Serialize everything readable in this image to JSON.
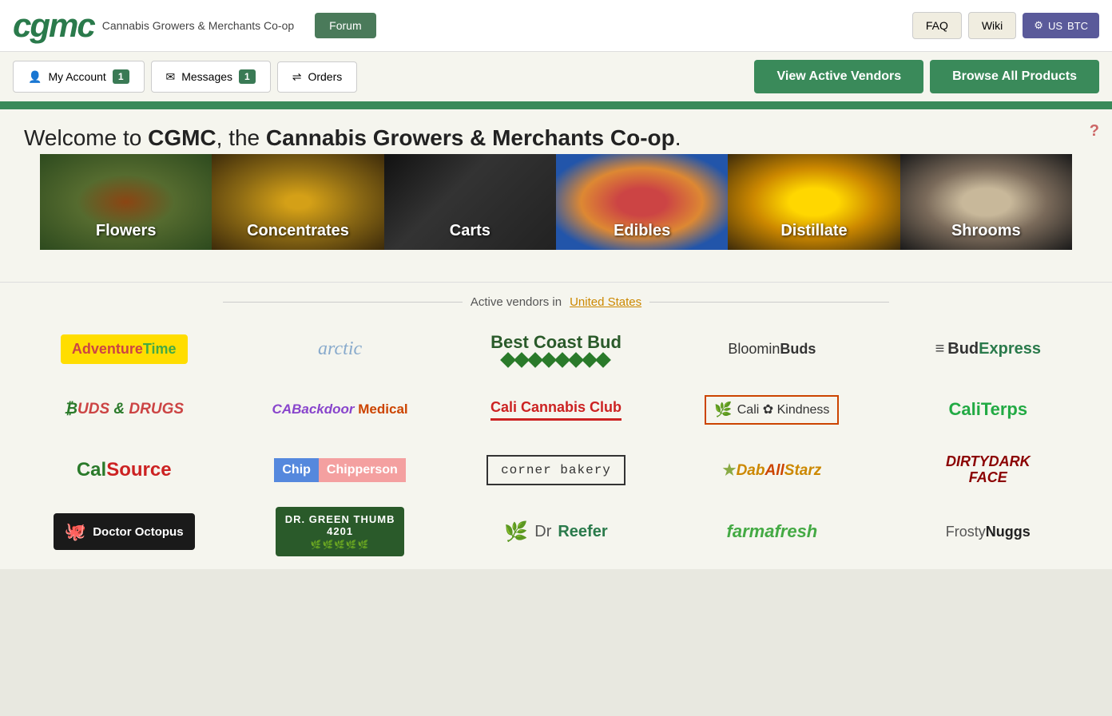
{
  "header": {
    "logo": "cgmc",
    "subtitle": "Cannabis Growers & Merchants Co-op",
    "forum_label": "Forum",
    "faq_label": "FAQ",
    "wiki_label": "Wiki",
    "settings_icon": "gear",
    "region": "US",
    "currency": "BTC"
  },
  "nav": {
    "my_account": "My Account",
    "my_account_badge": "1",
    "messages": "Messages",
    "messages_badge": "1",
    "orders": "Orders",
    "view_vendors": "View Active Vendors",
    "browse_products": "Browse All Products"
  },
  "welcome": {
    "text": "Welcome to CGMC, the Cannabis Growers & Merchants Co-op."
  },
  "categories": [
    {
      "id": "flowers",
      "label": "Flowers",
      "css_class": "cat-flowers"
    },
    {
      "id": "concentrates",
      "label": "Concentrates",
      "css_class": "cat-concentrates"
    },
    {
      "id": "carts",
      "label": "Carts",
      "css_class": "cat-carts"
    },
    {
      "id": "edibles",
      "label": "Edibles",
      "css_class": "cat-edibles"
    },
    {
      "id": "distillate",
      "label": "Distillate",
      "css_class": "cat-distillate"
    },
    {
      "id": "shrooms",
      "label": "Shrooms",
      "css_class": "cat-shrooms"
    }
  ],
  "vendors_header": {
    "prefix": "Active vendors in",
    "location": "United States"
  },
  "vendors": [
    {
      "id": "adventure-time",
      "name": "AdventureTime"
    },
    {
      "id": "arctic",
      "name": "arctic"
    },
    {
      "id": "best-coast-bud",
      "name": "Best Coast Bud"
    },
    {
      "id": "bloomin-buds",
      "name": "BloominBuds"
    },
    {
      "id": "bud-express",
      "name": "BudExpress"
    },
    {
      "id": "buds-drugs",
      "name": "Buds & Drugs"
    },
    {
      "id": "ca-backdoor",
      "name": "CABackdoor Medical"
    },
    {
      "id": "cali-cannabis",
      "name": "Cali Cannabis Club"
    },
    {
      "id": "cali-kindness",
      "name": "Cali Kindness"
    },
    {
      "id": "caliterps",
      "name": "CaliTerps"
    },
    {
      "id": "cal-source",
      "name": "Cal Source"
    },
    {
      "id": "chip-chipperson",
      "name": "Chip Chipperson"
    },
    {
      "id": "corner-bakery",
      "name": "corner bakery"
    },
    {
      "id": "dab-all-starz",
      "name": "DabAllStarz"
    },
    {
      "id": "dirty-dark-face",
      "name": "DIRTYDARK FACE"
    },
    {
      "id": "doctor-octopus",
      "name": "Doctor Octopus"
    },
    {
      "id": "dr-green-thumb",
      "name": "DR. GREEN THUMB 4201"
    },
    {
      "id": "dr-reefer",
      "name": "DrReefer"
    },
    {
      "id": "farmafresh",
      "name": "farmafresh"
    },
    {
      "id": "frosty-nuggs",
      "name": "FrostyNuggs"
    }
  ]
}
